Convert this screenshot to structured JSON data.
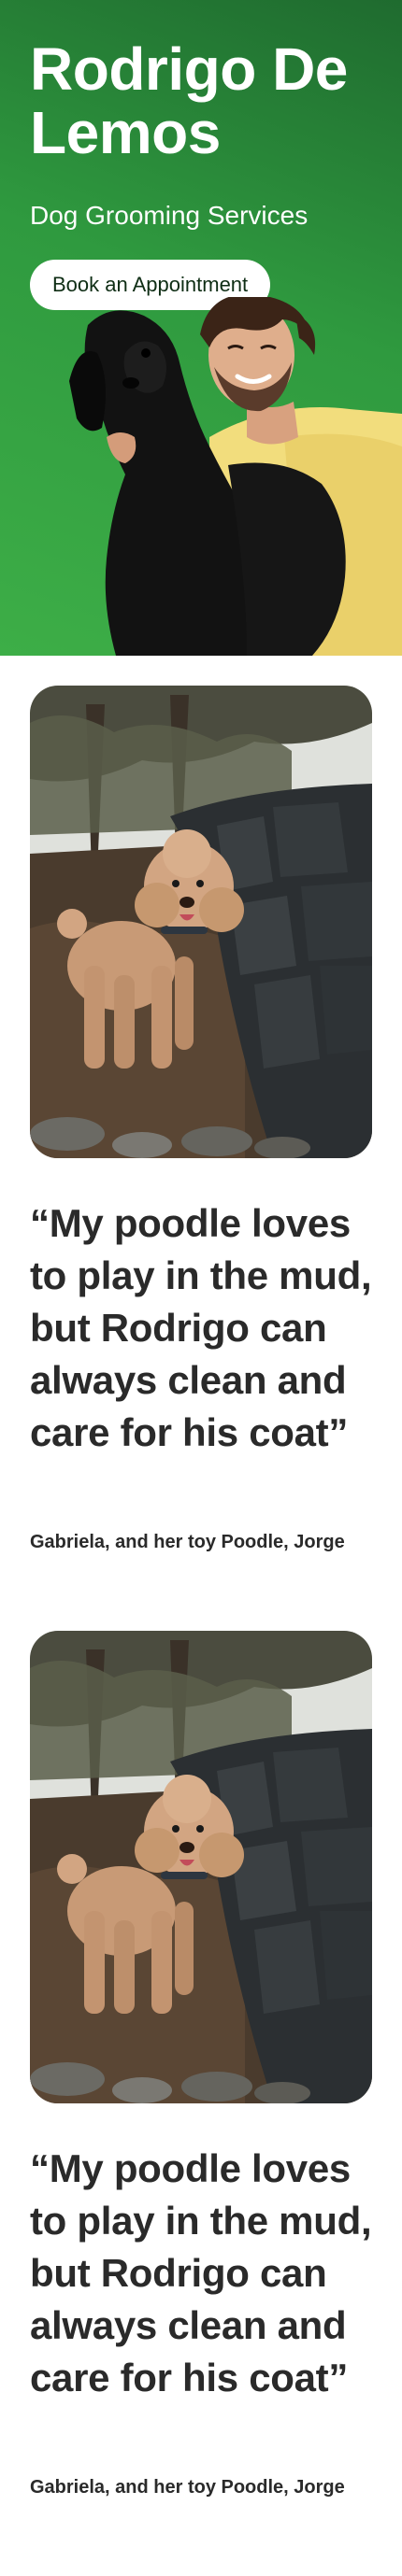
{
  "hero": {
    "name": "Rodrigo De Lemos",
    "subtitle": "Dog Grooming Services",
    "cta_label": "Book an Appointment"
  },
  "testimonials": [
    {
      "quote": "“My poodle loves to play in the mud, but Rodrigo can always clean and care for his coat”",
      "attribution": "Gabriela, and her toy Poodle, Jorge"
    },
    {
      "quote": "“My poodle loves to play in the mud, but Rodrigo can always clean and care for his coat”",
      "attribution": "Gabriela, and her toy Poodle, Jorge"
    }
  ],
  "colors": {
    "hero_green": "#2f9a3f",
    "text_dark": "#2a2a2a",
    "button_text": "#0e2d14"
  }
}
